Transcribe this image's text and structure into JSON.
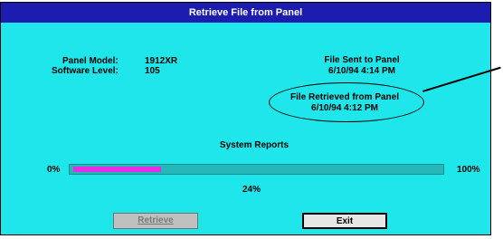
{
  "window": {
    "title": "Retrieve File from Panel"
  },
  "panel": {
    "model_label": "Panel Model:",
    "model_value": "1912XR",
    "software_label": "Software Level:",
    "software_value": "105"
  },
  "sent": {
    "label": "File Sent to Panel",
    "datetime": "6/10/94 4:14 PM"
  },
  "retrieved": {
    "label": "File Retrieved from Panel",
    "datetime": "6/10/94 4:12 PM"
  },
  "reports": {
    "label": "System Reports"
  },
  "progress": {
    "min_label": "0%",
    "max_label": "100%",
    "current_label": "24%",
    "fraction": 0.24
  },
  "buttons": {
    "retrieve": "Retrieve",
    "exit": "Exit"
  },
  "colors": {
    "window_bg": "#1ee6ea",
    "titlebar": "#1c1cae",
    "progress_fill": "#e62ee6"
  }
}
